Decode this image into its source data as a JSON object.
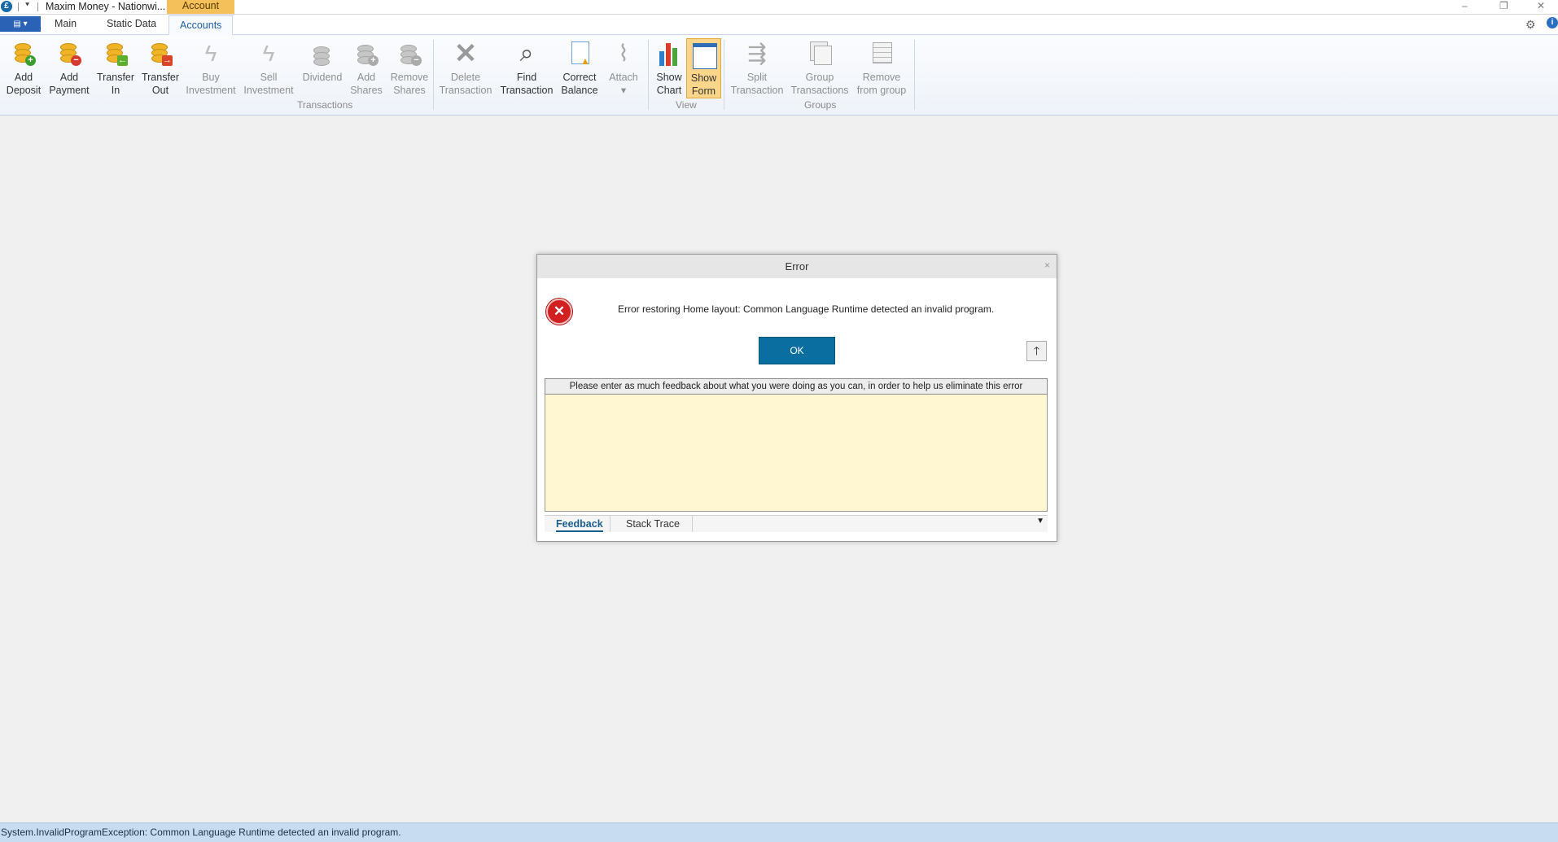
{
  "window": {
    "title": "Maxim Money - Nationwi...",
    "context_tab": "Account",
    "controls": [
      "–",
      "❐",
      "✕"
    ]
  },
  "ribbon_tabs": {
    "main": "Main",
    "static_data": "Static Data",
    "accounts": "Accounts"
  },
  "ribbon": {
    "add_deposit": "Add\nDeposit",
    "add_payment": "Add\nPayment",
    "transfer_in": "Transfer\nIn",
    "transfer_out": "Transfer\nOut",
    "buy_investment": "Buy\nInvestment",
    "sell_investment": "Sell\nInvestment",
    "dividend": "Dividend",
    "add_shares": "Add\nShares",
    "remove_shares": "Remove\nShares",
    "delete_transaction": "Delete\nTransaction",
    "find_transaction": "Find\nTransaction",
    "correct_balance": "Correct\nBalance",
    "attach": "Attach\n▾",
    "show_chart": "Show\nChart",
    "show_form": "Show\nForm",
    "split_transaction": "Split\nTransaction",
    "group_transactions": "Group\nTransactions",
    "remove_from_group": "Remove\nfrom group",
    "group_transactions_label": "Transactions",
    "group_view_label": "View",
    "group_groups_label": "Groups"
  },
  "dialog": {
    "title": "Error",
    "close": "×",
    "message": "Error restoring Home layout: Common Language Runtime detected an invalid program.",
    "ok": "OK",
    "up_arrow": "🡑",
    "feedback_prompt": "Please enter as much feedback about what you were doing as you can, in order to help us eliminate this error",
    "feedback_value": "",
    "tabs": {
      "feedback": "Feedback",
      "stack_trace": "Stack Trace"
    },
    "dropdown": "▼"
  },
  "status": {
    "text": "System.InvalidProgramException: Common Language Runtime detected an invalid program."
  }
}
